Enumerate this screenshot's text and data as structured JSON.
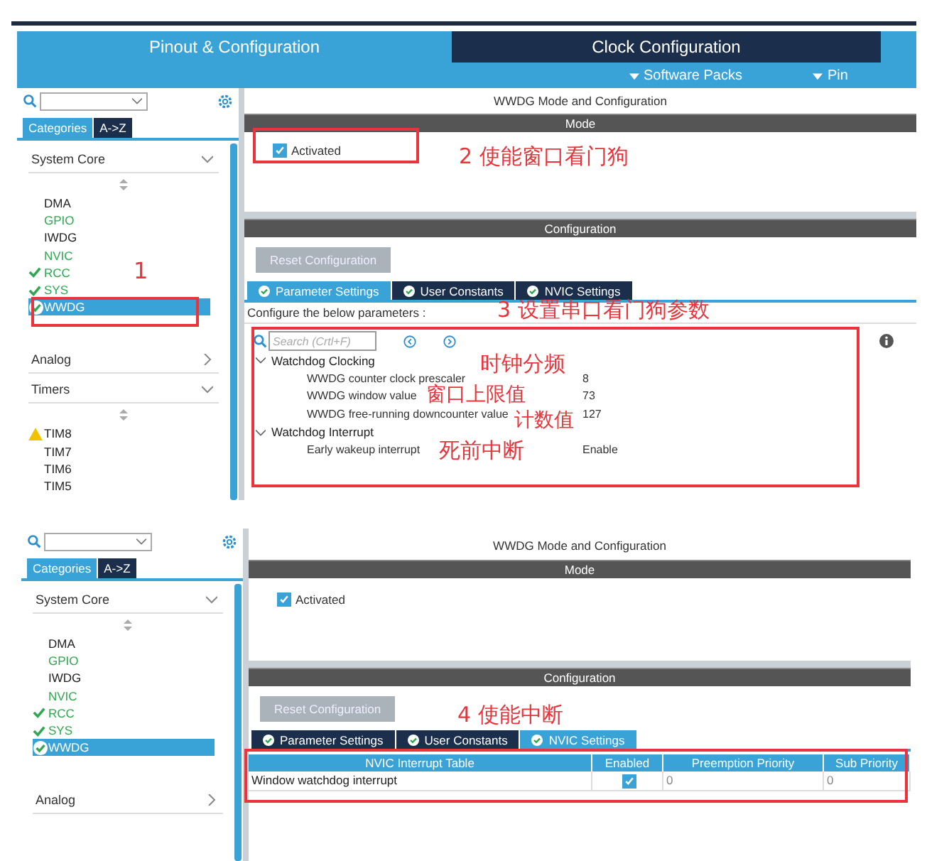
{
  "panels": [
    {
      "header": {
        "tabs": [
          {
            "label": "Pinout & Configuration",
            "selected": true
          },
          {
            "label": "Clock Configuration",
            "selected": false
          }
        ],
        "subtabs": [
          "Software Packs",
          "Pin"
        ]
      },
      "sidebar": {
        "view_tabs": [
          {
            "label": "Categories",
            "selected": true
          },
          {
            "label": "A->Z",
            "selected": false
          }
        ],
        "categories": [
          {
            "name": "System Core",
            "expanded": true,
            "items": [
              {
                "label": "DMA",
                "kind": "plain",
                "selected": false
              },
              {
                "label": "GPIO",
                "kind": "configured",
                "selected": false
              },
              {
                "label": "IWDG",
                "kind": "plain",
                "selected": false
              },
              {
                "label": "NVIC",
                "kind": "configured",
                "selected": false
              },
              {
                "label": "RCC",
                "kind": "ok",
                "selected": false
              },
              {
                "label": "SYS",
                "kind": "ok",
                "selected": false
              },
              {
                "label": "WWDG",
                "kind": "ok",
                "selected": true
              }
            ]
          },
          {
            "name": "Analog",
            "expanded": false
          },
          {
            "name": "Timers",
            "expanded": true,
            "items": [
              {
                "label": "TIM8",
                "kind": "warning",
                "selected": false
              },
              {
                "label": "TIM7",
                "kind": "plain",
                "selected": false
              },
              {
                "label": "TIM6",
                "kind": "plain",
                "selected": false
              },
              {
                "label": "TIM5",
                "kind": "plain",
                "selected": false
              }
            ]
          }
        ]
      },
      "main": {
        "title": "WWDG Mode and Configuration",
        "mode_header": "Mode",
        "activated": {
          "label": "Activated",
          "checked": true
        },
        "config_header": "Configuration",
        "reset_button": "Reset Configuration",
        "config_tabs": [
          {
            "label": "Parameter Settings",
            "selected": true
          },
          {
            "label": "User Constants",
            "selected": false
          },
          {
            "label": "NVIC Settings",
            "selected": false
          }
        ],
        "content": {
          "kind": "parameters",
          "hint": "Configure the below parameters :",
          "search_placeholder": "Search (Crtl+F)",
          "groups": [
            {
              "name": "Watchdog Clocking",
              "expanded": true,
              "params": [
                {
                  "name": "WWDG counter clock prescaler",
                  "value": "8"
                },
                {
                  "name": "WWDG window value",
                  "value": "73"
                },
                {
                  "name": "WWDG free-running downcounter value",
                  "value": "127"
                }
              ]
            },
            {
              "name": "Watchdog Interrupt",
              "expanded": true,
              "params": [
                {
                  "name": "Early wakeup interrupt",
                  "value": "Enable"
                }
              ]
            }
          ]
        }
      },
      "notes": [
        "1",
        "2 使能窗口看门狗",
        "3 设置串口看门狗参数",
        "时钟分频",
        "窗口上限值",
        "计数值",
        "死前中断"
      ]
    },
    {
      "sidebar": {
        "view_tabs": [
          {
            "label": "Categories",
            "selected": true
          },
          {
            "label": "A->Z",
            "selected": false
          }
        ],
        "categories": [
          {
            "name": "System Core",
            "expanded": true,
            "items": [
              {
                "label": "DMA",
                "kind": "plain",
                "selected": false
              },
              {
                "label": "GPIO",
                "kind": "configured",
                "selected": false
              },
              {
                "label": "IWDG",
                "kind": "plain",
                "selected": false
              },
              {
                "label": "NVIC",
                "kind": "configured",
                "selected": false
              },
              {
                "label": "RCC",
                "kind": "ok",
                "selected": false
              },
              {
                "label": "SYS",
                "kind": "ok",
                "selected": false
              },
              {
                "label": "WWDG",
                "kind": "ok",
                "selected": true
              }
            ]
          },
          {
            "name": "Analog",
            "expanded": false
          }
        ]
      },
      "main": {
        "title": "WWDG Mode and Configuration",
        "mode_header": "Mode",
        "activated": {
          "label": "Activated",
          "checked": true
        },
        "config_header": "Configuration",
        "reset_button": "Reset Configuration",
        "config_tabs": [
          {
            "label": "Parameter Settings",
            "selected": false
          },
          {
            "label": "User Constants",
            "selected": false
          },
          {
            "label": "NVIC Settings",
            "selected": true
          }
        ],
        "content": {
          "kind": "nvic",
          "columns": [
            "NVIC Interrupt Table",
            "Enabled",
            "Preemption Priority",
            "Sub Priority"
          ],
          "rows": [
            {
              "name": "Window watchdog interrupt",
              "enabled": true,
              "preemption": "0",
              "sub": "0"
            }
          ]
        }
      },
      "notes": [
        "4 使能中断"
      ]
    }
  ]
}
